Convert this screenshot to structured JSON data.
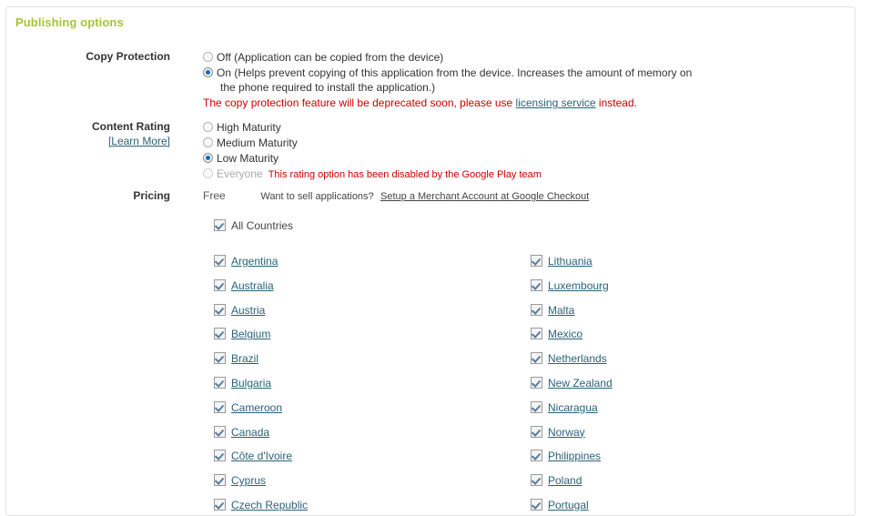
{
  "panel": {
    "title": "Publishing options"
  },
  "copy_protection": {
    "label": "Copy Protection",
    "options": [
      {
        "text": "Off (Application can be copied from the device)",
        "checked": false
      },
      {
        "text": "On (Helps prevent copying of this application from the device. Increases the amount of memory on",
        "continuation": "the phone required to install the application.)",
        "checked": true
      }
    ],
    "notice_before": "The copy protection feature will be deprecated soon, please use ",
    "notice_link": "licensing service",
    "notice_after": " instead."
  },
  "content_rating": {
    "label": "Content Rating",
    "learn_more": "[Learn More]",
    "options": [
      {
        "text": "High Maturity",
        "checked": false,
        "disabled": false
      },
      {
        "text": "Medium Maturity",
        "checked": false,
        "disabled": false
      },
      {
        "text": "Low Maturity",
        "checked": true,
        "disabled": false
      },
      {
        "text": "Everyone",
        "checked": false,
        "disabled": true,
        "note": "This rating option has been disabled by the Google Play team"
      }
    ]
  },
  "pricing": {
    "label": "Pricing",
    "value": "Free",
    "sell_question": "Want to sell applications?",
    "sell_link": "Setup a Merchant Account at Google Checkout"
  },
  "countries": {
    "all_label": "All Countries",
    "all_checked": true,
    "left": [
      {
        "name": "Argentina",
        "checked": true
      },
      {
        "name": "Australia",
        "checked": true
      },
      {
        "name": "Austria",
        "checked": true
      },
      {
        "name": "Belgium",
        "checked": true
      },
      {
        "name": "Brazil",
        "checked": true
      },
      {
        "name": "Bulgaria",
        "checked": true
      },
      {
        "name": "Cameroon",
        "checked": true
      },
      {
        "name": "Canada",
        "checked": true
      },
      {
        "name": "Côte d'Ivoire",
        "checked": true
      },
      {
        "name": "Cyprus",
        "checked": true
      },
      {
        "name": "Czech Republic",
        "checked": true
      }
    ],
    "right": [
      {
        "name": "Lithuania",
        "checked": true
      },
      {
        "name": "Luxembourg",
        "checked": true
      },
      {
        "name": "Malta",
        "checked": true
      },
      {
        "name": "Mexico",
        "checked": true
      },
      {
        "name": "Netherlands",
        "checked": true
      },
      {
        "name": "New Zealand",
        "checked": true
      },
      {
        "name": "Nicaragua",
        "checked": true
      },
      {
        "name": "Norway",
        "checked": true
      },
      {
        "name": "Philippines",
        "checked": true
      },
      {
        "name": "Poland",
        "checked": true
      },
      {
        "name": "Portugal",
        "checked": true
      }
    ]
  },
  "colors": {
    "title": "#a5c535",
    "link": "#2a6179",
    "warning": "#cc0000",
    "radio_dot": "#0b6cbf",
    "check": "#5a7c9e"
  }
}
